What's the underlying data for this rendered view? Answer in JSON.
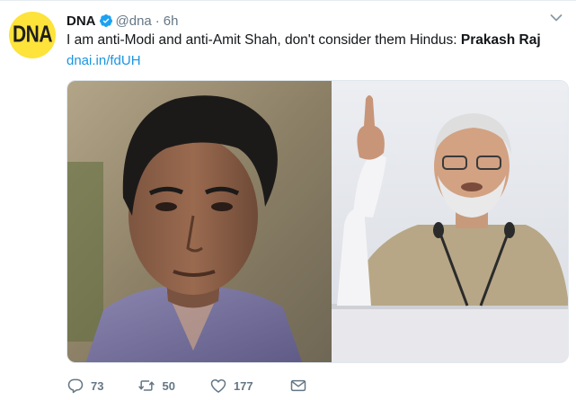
{
  "tweet": {
    "author": {
      "name": "DNA",
      "handle": "@dna",
      "avatar_text": "DNA",
      "verified": true
    },
    "separator": "·",
    "time": "6h",
    "text_main": "I am anti-Modi and anti-Amit Shah, don't consider them Hindus: ",
    "text_bold": "Prakash Raj",
    "link": "dnai.in/fdUH",
    "media_alt": "Photo collage: portrait of a man on the left, politician speaking at a podium on the right"
  },
  "actions": {
    "reply_count": "73",
    "retweet_count": "50",
    "like_count": "177"
  },
  "icons": [
    "verified-badge-icon",
    "chevron-down-icon",
    "reply-icon",
    "retweet-icon",
    "like-icon",
    "message-icon"
  ],
  "colors": {
    "accent": "#1b95e0",
    "muted": "#657786",
    "avatar_bg": "#fde33a"
  }
}
